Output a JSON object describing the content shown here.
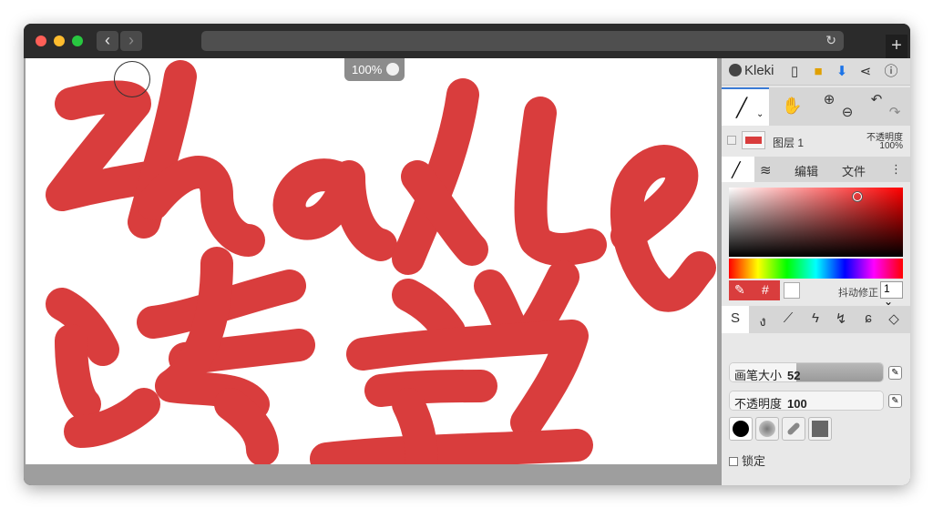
{
  "window": {
    "traffic_colors": [
      "#ff5f57",
      "#febc2e",
      "#28c840"
    ]
  },
  "nav": {
    "back": "‹",
    "forward": "›",
    "reload": "↻",
    "new_tab": "+"
  },
  "canvas": {
    "zoom": "100%",
    "ink_color": "#d93d3d"
  },
  "panel": {
    "logo": "Kleki",
    "layer": {
      "name": "图层 1",
      "opacity_label": "不透明度",
      "opacity_value": "100%"
    },
    "tabs": {
      "edit": "编辑",
      "file": "文件",
      "more": "⋮"
    },
    "color": {
      "primary": "#d93d3d",
      "secondary": "#ffffff",
      "eyedropper": "✎",
      "hex": "#"
    },
    "jitter": {
      "label": "抖动修正",
      "value": "1"
    },
    "brush_size": {
      "label": "画笔大小",
      "value": "52",
      "fraction": 0.43
    },
    "opacity": {
      "label": "不透明度",
      "value": "100",
      "fraction": 1.0
    },
    "lock": {
      "label": "锁定"
    }
  }
}
